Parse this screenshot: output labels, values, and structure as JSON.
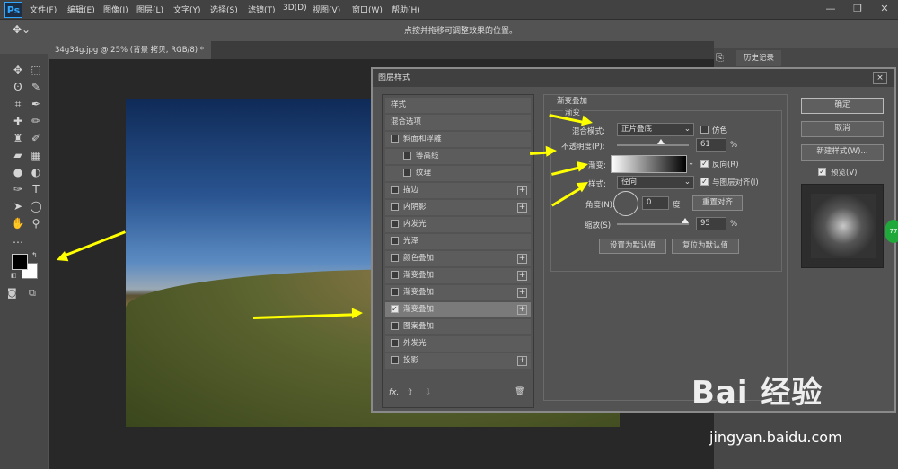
{
  "app": {
    "logo": "Ps",
    "window_controls": [
      "—",
      "❐",
      "✕"
    ]
  },
  "menus": [
    "文件(F)",
    "编辑(E)",
    "图像(I)",
    "图层(L)",
    "文字(Y)",
    "选择(S)",
    "滤镜(T)",
    "3D(D)",
    "视图(V)",
    "窗口(W)",
    "帮助(H)"
  ],
  "options_bar": {
    "hint": "点按并拖移可调整效果的位置。"
  },
  "document_tab": {
    "label": "34g34g.jpg @ 25% (背景 拷贝, RGB/8) *",
    "close": "×"
  },
  "right_panel": {
    "history_tab": "历史记录"
  },
  "dialog": {
    "title": "图层样式",
    "close": "×",
    "styles": [
      {
        "label": "样式",
        "checkbox": false,
        "plus": false
      },
      {
        "label": "混合选项",
        "checkbox": false,
        "plus": false
      },
      {
        "label": "斜面和浮雕",
        "checkbox": true,
        "checked": false,
        "plus": false
      },
      {
        "label": "等高线",
        "checkbox": true,
        "checked": false,
        "plus": false,
        "indent": true
      },
      {
        "label": "纹理",
        "checkbox": true,
        "checked": false,
        "plus": false,
        "indent": true
      },
      {
        "label": "描边",
        "checkbox": true,
        "checked": false,
        "plus": true
      },
      {
        "label": "内阴影",
        "checkbox": true,
        "checked": false,
        "plus": true
      },
      {
        "label": "内发光",
        "checkbox": true,
        "checked": false,
        "plus": false
      },
      {
        "label": "光泽",
        "checkbox": true,
        "checked": false,
        "plus": false
      },
      {
        "label": "颜色叠加",
        "checkbox": true,
        "checked": false,
        "plus": true
      },
      {
        "label": "渐变叠加",
        "checkbox": true,
        "checked": false,
        "plus": true
      },
      {
        "label": "渐变叠加",
        "checkbox": true,
        "checked": false,
        "plus": true
      },
      {
        "label": "渐变叠加",
        "checkbox": true,
        "checked": true,
        "plus": true,
        "selected": true
      },
      {
        "label": "图案叠加",
        "checkbox": true,
        "checked": false,
        "plus": false
      },
      {
        "label": "外发光",
        "checkbox": true,
        "checked": false,
        "plus": false
      },
      {
        "label": "投影",
        "checkbox": true,
        "checked": false,
        "plus": true
      }
    ],
    "list_footer": {
      "fx": "fx.",
      "up": "⇧",
      "down": "⇩",
      "trash": "🗑"
    },
    "section_title": "渐变叠加",
    "group_title": "渐变",
    "blend_mode": {
      "label": "混合模式:",
      "value": "正片叠底"
    },
    "dither": {
      "label": "仿色",
      "checked": false
    },
    "opacity": {
      "label": "不透明度(P):",
      "value": "61",
      "unit": "%",
      "level": 0.61
    },
    "gradient": {
      "label": "渐变:"
    },
    "reverse": {
      "label": "反向(R)",
      "checked": true
    },
    "style": {
      "label": "样式:",
      "value": "径向"
    },
    "align": {
      "label": "与图层对齐(I)",
      "checked": true
    },
    "angle": {
      "label": "角度(N):",
      "value": "0",
      "unit": "度"
    },
    "reset_align": "重置对齐",
    "scale": {
      "label": "缩放(S):",
      "value": "95",
      "unit": "%",
      "level": 0.95
    },
    "make_default": "设置为默认值",
    "reset_default": "复位为默认值",
    "ok": "确定",
    "cancel": "取消",
    "new_style": "新建样式(W)...",
    "preview": {
      "label": "预览(V)",
      "checked": true
    }
  },
  "watermark": {
    "brand": "Bai 经验",
    "site": "jingyan.baidu.com"
  },
  "badge": "77",
  "colors": {
    "arrow": "#ffff00",
    "menubar": "#424242",
    "panel": "#535353"
  }
}
